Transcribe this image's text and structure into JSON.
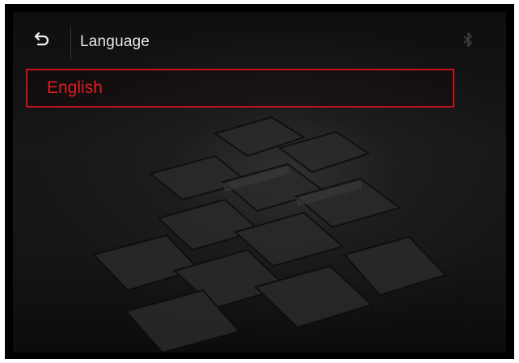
{
  "header": {
    "title": "Language",
    "back_icon": "back-arrow-icon",
    "status_icon": "bluetooth-icon"
  },
  "languages": {
    "items": [
      {
        "label": "English",
        "selected": true
      }
    ]
  },
  "colors": {
    "accent": "#c4141a",
    "accent_text": "#e01c22",
    "title_text": "#e6e6e6",
    "background": "#151515"
  }
}
